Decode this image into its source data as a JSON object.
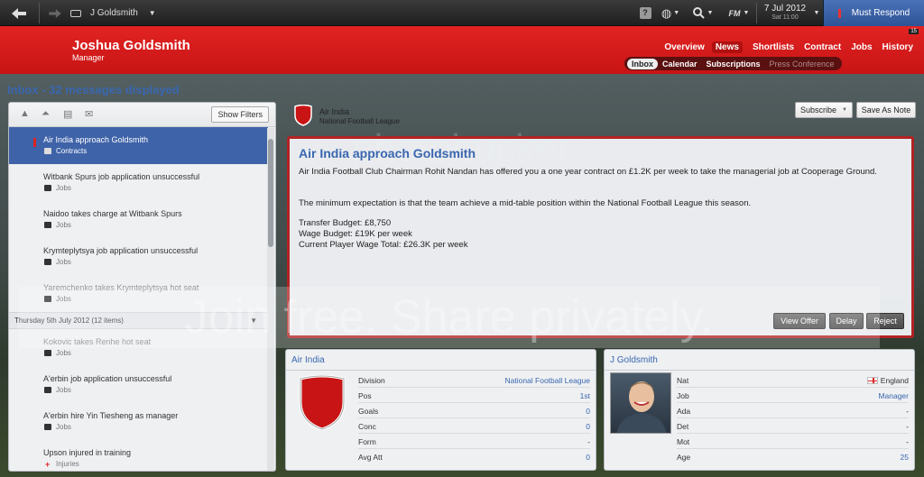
{
  "topbar": {
    "manager_name": "J Goldsmith",
    "date": "7 Jul 2012",
    "day_time": "Sat 11:00",
    "respond_label": "Must Respond",
    "fm_label": "FM"
  },
  "header": {
    "name": "Joshua Goldsmith",
    "role": "Manager",
    "nav": [
      "Overview",
      "News",
      "Shortlists",
      "Contract",
      "Jobs",
      "History"
    ],
    "active_nav": "News",
    "subnav": [
      "Inbox",
      "Calendar",
      "Subscriptions",
      "Press Conference"
    ],
    "active_subnav": "Inbox",
    "badge": "15"
  },
  "inbox": {
    "title": "Inbox - 32 messages displayed",
    "show_filters": "Show Filters",
    "group_label": "Thursday 5th July 2012 (12 items)",
    "messages": [
      {
        "title": "Air India approach Goldsmith",
        "category": "Contracts"
      },
      {
        "title": "Witbank Spurs job application unsuccessful",
        "category": "Jobs"
      },
      {
        "title": "Naidoo takes charge at Witbank Spurs",
        "category": "Jobs"
      },
      {
        "title": "Krymteplytsya job application unsuccessful",
        "category": "Jobs"
      },
      {
        "title": "Yaremchenko takes Krymteplytsya hot seat",
        "category": "Jobs"
      },
      {
        "title": "Kokovic takes Renhe hot seat",
        "category": "Jobs"
      },
      {
        "title": "A'erbin job application unsuccessful",
        "category": "Jobs"
      },
      {
        "title": "A'erbin hire Yin Tiesheng as manager",
        "category": "Jobs"
      },
      {
        "title": "Upson injured in training",
        "category": "Injuries"
      }
    ]
  },
  "message": {
    "club": "Air India",
    "league": "National Football League",
    "subscribe_label": "Subscribe",
    "save_note_label": "Save As Note",
    "title": "Air India approach Goldsmith",
    "para1": "Air India Football Club Chairman Rohit Nandan has offered you a one year contract on £1.2K per week to take the managerial job at Cooperage Ground.",
    "para2": "The minimum expectation is that the team achieve a mid-table position within the National Football League this season.",
    "line1": "Transfer Budget: £8,750",
    "line2": "Wage Budget: £19K per week",
    "line3": "Current Player Wage Total: £26.3K per week",
    "view_offer": "View Offer",
    "delay": "Delay",
    "reject": "Reject"
  },
  "club_card": {
    "title": "Air India",
    "rows": [
      {
        "k": "Division",
        "v": "National Football League"
      },
      {
        "k": "Pos",
        "v": "1st"
      },
      {
        "k": "Goals",
        "v": "0"
      },
      {
        "k": "Conc",
        "v": "0"
      },
      {
        "k": "Form",
        "v": "-"
      },
      {
        "k": "Avg Att",
        "v": "0"
      }
    ]
  },
  "person_card": {
    "title": "J Goldsmith",
    "rows": [
      {
        "k": "Nat",
        "v": "England"
      },
      {
        "k": "Job",
        "v": "Manager"
      },
      {
        "k": "Ada",
        "v": "-"
      },
      {
        "k": "Det",
        "v": "-"
      },
      {
        "k": "Mot",
        "v": "-"
      },
      {
        "k": "Age",
        "v": "25"
      }
    ]
  },
  "watermark": {
    "top": "photobucket",
    "main": "Join free. Share privately."
  },
  "colors": {
    "accent": "#3a67b0",
    "header_red": "#d61a1a",
    "selected": "#3f63a8"
  }
}
